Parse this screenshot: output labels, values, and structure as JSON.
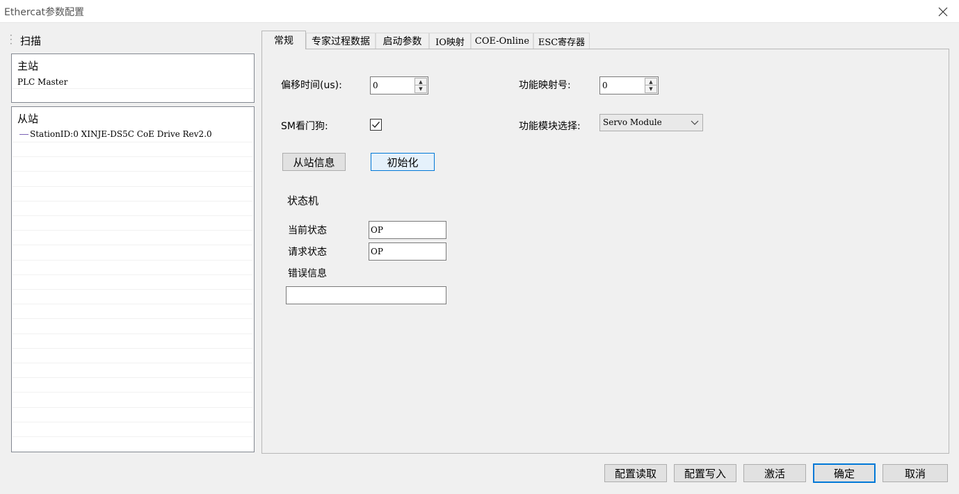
{
  "window": {
    "title": "Ethercat参数配置"
  },
  "scan": {
    "label": "扫描"
  },
  "master": {
    "heading": "主站",
    "item": "PLC Master"
  },
  "slave": {
    "heading": "从站",
    "item": "StationID:0 XINJE-DS5C CoE Drive Rev2.0"
  },
  "tabs": [
    {
      "label": "常规"
    },
    {
      "label": "专家过程数据"
    },
    {
      "label": "启动参数"
    },
    {
      "label": "IO映射"
    },
    {
      "label": "COE-Online"
    },
    {
      "label": "ESC寄存器"
    }
  ],
  "general": {
    "offset_time_label": "偏移时间(us):",
    "offset_time_value": "0",
    "func_map_label": "功能映射号:",
    "func_map_value": "0",
    "sm_watchdog_label": "SM看门狗:",
    "sm_watchdog_checked": true,
    "func_module_label": "功能模块选择:",
    "func_module_value": "Servo Module",
    "slave_info_button": "从站信息",
    "init_button": "初始化",
    "state_machine_label": "状态机",
    "current_state_label": "当前状态",
    "current_state_value": "OP",
    "request_state_label": "请求状态",
    "request_state_value": "OP",
    "error_info_label": "错误信息",
    "error_info_value": ""
  },
  "footer": {
    "read_config": "配置读取",
    "write_config": "配置写入",
    "activate": "激活",
    "ok": "确定",
    "cancel": "取消"
  }
}
